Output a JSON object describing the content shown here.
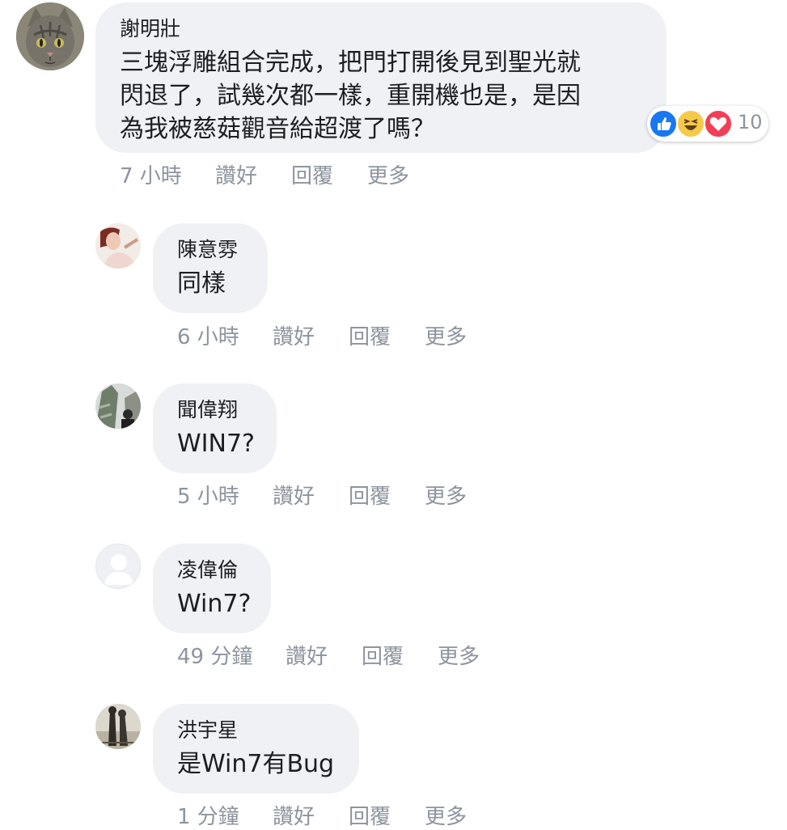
{
  "comments": [
    {
      "author": "謝明壯",
      "lines": [
        "三塊浮雕組合完成，把門打開後見到聖光就",
        "閃退了，試幾次都一樣，重開機也是，是因",
        "為我被慈菇觀音給超渡了嗎？"
      ],
      "time": "7 小時",
      "like": "讚好",
      "reply": "回覆",
      "more": "更多",
      "reaction_count": "10",
      "reaction_icons": [
        "like-icon",
        "haha-icon",
        "love-icon"
      ]
    },
    {
      "author": "陳意雰",
      "text": "同樣",
      "time": "6 小時",
      "like": "讚好",
      "reply": "回覆",
      "more": "更多"
    },
    {
      "author": "聞偉翔",
      "text": "WIN7?",
      "time": "5 小時",
      "like": "讚好",
      "reply": "回覆",
      "more": "更多"
    },
    {
      "author": "凌偉倫",
      "text": "Win7?",
      "time": "49 分鐘",
      "like": "讚好",
      "reply": "回覆",
      "more": "更多"
    },
    {
      "author": "洪宇星",
      "text": "是Win7有Bug",
      "time": "1 分鐘",
      "like": "讚好",
      "reply": "回覆",
      "more": "更多"
    }
  ],
  "colors": {
    "bubble": "#eff1f4",
    "meta": "#8d949e",
    "like": "#1877f2",
    "haha": "#f7c94b",
    "love": "#f33e58"
  }
}
